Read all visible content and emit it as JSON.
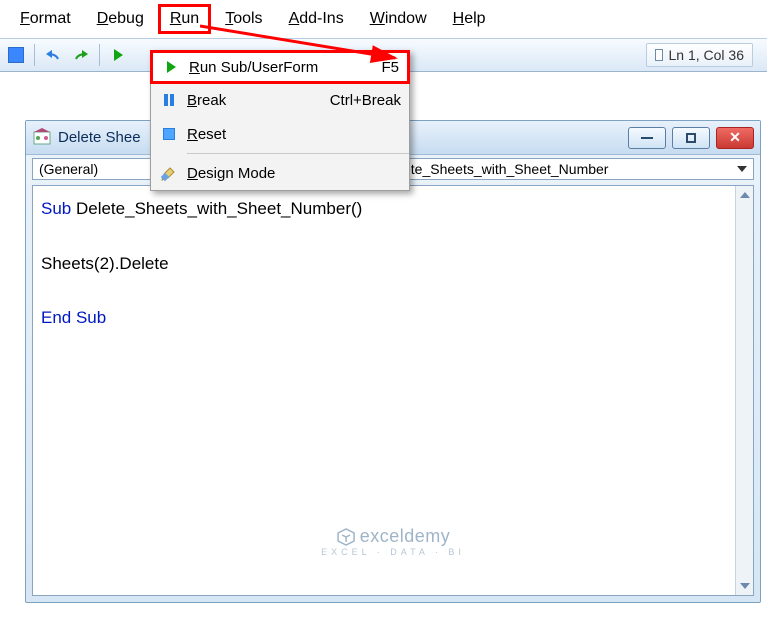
{
  "menubar": {
    "format": "ormat",
    "format_u": "F",
    "debug": "ebug",
    "debug_u": "D",
    "run": "un",
    "run_u": "R",
    "tools": "ools",
    "tools_u": "T",
    "addins": "dd-Ins",
    "addins_u": "A",
    "window": "indow",
    "window_u": "W",
    "help": "elp",
    "help_u": "H"
  },
  "toolbar": {
    "status": "Ln 1, Col 36"
  },
  "dropdown": {
    "run_label": "Run Sub/UserForm",
    "run_u": "R",
    "run_key": "F5",
    "break_label": "reak",
    "break_u": "B",
    "break_key": "Ctrl+Break",
    "reset_u": "R",
    "reset_label": "eset",
    "design_label": "esign Mode",
    "design_u": "D"
  },
  "window": {
    "title": "Delete Shee",
    "combo_left": "(General)",
    "combo_right": "ete_Sheets_with_Sheet_Number"
  },
  "code": {
    "sub_kw": "Sub",
    "sub_name": " Delete_Sheets_with_Sheet_Number()",
    "body": "Sheets(2).Delete",
    "end_kw": "End Sub"
  },
  "watermark": {
    "brand": "exceldemy",
    "tagline": "EXCEL · DATA · BI"
  }
}
